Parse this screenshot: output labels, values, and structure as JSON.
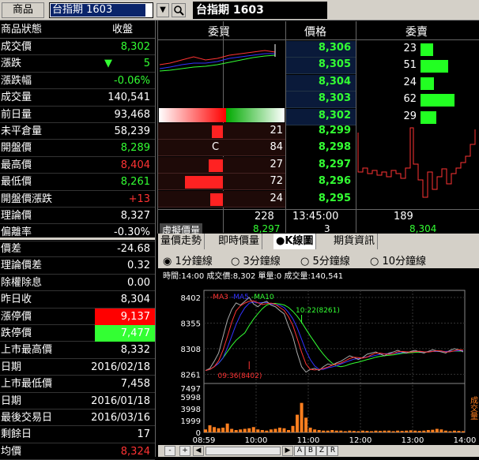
{
  "top": {
    "product_label": "商品",
    "input_value": "台指期  1603",
    "title": "台指期   1603"
  },
  "left_header": {
    "k": "商品狀態",
    "v": "收盤"
  },
  "left_rows": [
    {
      "k": "成交價",
      "v": "8,302",
      "c": "g"
    },
    {
      "k": "漲跌",
      "v": "5",
      "c": "g",
      "arrow": "▼"
    },
    {
      "k": "漲跌幅",
      "v": "-0.06%",
      "c": "g"
    },
    {
      "k": "成交量",
      "v": "140,541",
      "c": "w"
    },
    {
      "k": "前日量",
      "v": "93,468",
      "c": "w"
    },
    {
      "k": "未平倉量",
      "v": "58,239",
      "c": "w"
    },
    {
      "k": "開盤價",
      "v": "8,289",
      "c": "g"
    },
    {
      "k": "最高價",
      "v": "8,404",
      "c": "r"
    },
    {
      "k": "最低價",
      "v": "8,261",
      "c": "g"
    },
    {
      "k": "開盤價漲跌",
      "v": "+13",
      "c": "r"
    },
    {
      "k": "理論價",
      "v": "8,327",
      "c": "w"
    },
    {
      "k": "偏離率",
      "v": "-0.30%",
      "c": "w"
    }
  ],
  "left_rows2": [
    {
      "k": "價差",
      "v": "-24.68",
      "c": "w"
    },
    {
      "k": "理論價差",
      "v": "0.32",
      "c": "w"
    },
    {
      "k": "除權除息",
      "v": "0.00",
      "c": "w"
    },
    {
      "k": "昨日收",
      "v": "8,304",
      "c": "w"
    },
    {
      "k": "漲停價",
      "v": "9,137",
      "c": "w",
      "bg": "#ff0000"
    },
    {
      "k": "跌停價",
      "v": "7,477",
      "c": "w",
      "bg": "#33ff33"
    },
    {
      "k": "上市最高價",
      "v": "8,332",
      "c": "w"
    },
    {
      "k": "日期",
      "v": "2016/02/18",
      "c": "w"
    },
    {
      "k": "上市最低價",
      "v": "7,458",
      "c": "w"
    },
    {
      "k": "日期",
      "v": "2016/01/18",
      "c": "w"
    },
    {
      "k": "最後交易日",
      "v": "2016/03/16",
      "c": "w"
    },
    {
      "k": "剩餘日",
      "v": "17",
      "c": "w"
    },
    {
      "k": "均價",
      "v": "8,324",
      "c": "r"
    }
  ],
  "book_header": {
    "bid": "委買",
    "price": "價格",
    "ask": "委賣"
  },
  "asks": [
    {
      "price": "8,306",
      "qty": "23",
      "bar": 0.25
    },
    {
      "price": "8,305",
      "qty": "51",
      "bar": 0.55
    },
    {
      "price": "8,304",
      "qty": "24",
      "bar": 0.26
    },
    {
      "price": "8,303",
      "qty": "62",
      "bar": 0.67
    },
    {
      "price": "8,302",
      "qty": "29",
      "bar": 0.32
    }
  ],
  "bids": [
    {
      "price": "8,299",
      "qty": "21",
      "bar": 0.22,
      "mark": ""
    },
    {
      "price": "8,298",
      "qty": "84",
      "bar": 0.0,
      "mark": "C"
    },
    {
      "price": "8,297",
      "qty": "27",
      "bar": 0.28
    },
    {
      "price": "8,296",
      "qty": "72",
      "bar": 0.75
    },
    {
      "price": "8,295",
      "qty": "24",
      "bar": 0.25
    }
  ],
  "book_footer": {
    "bid_total": "228",
    "time": "13:45:00",
    "ask_total": "189",
    "sim_label": "虛擬價量",
    "sim_price": "8,297",
    "sim_qty": "3",
    "sim_ask": "8,304"
  },
  "tabs": [
    "量價走勢",
    "即時價量",
    "●K線圖",
    "期貨資訊"
  ],
  "radios": [
    "1分鐘線",
    "3分鐘線",
    "5分鐘線",
    "10分鐘線"
  ],
  "chart_data": {
    "type": "line",
    "info_bar": "時間:14:00  成交價:8,302  單量:0  成交量:140,541",
    "legend": [
      "MA3",
      "MA5",
      "MA10"
    ],
    "x_ticks": [
      "08:59",
      "10:00",
      "11:00",
      "12:00",
      "13:00",
      "14:00"
    ],
    "y_ticks": [
      "8402",
      "8355",
      "8308",
      "8261"
    ],
    "vol_ticks": [
      "7497",
      "5998",
      "3998",
      "1999",
      "0"
    ],
    "vol_label": "成交量",
    "annotations": [
      "10:22(8261)",
      "09:36(8402)"
    ],
    "ylim": [
      8250,
      8415
    ],
    "price": [
      8268,
      8272,
      8285,
      8300,
      8330,
      8360,
      8380,
      8392,
      8388,
      8395,
      8402,
      8390,
      8385,
      8392,
      8395,
      8388,
      8385,
      8378,
      8372,
      8350,
      8330,
      8300,
      8275,
      8265,
      8270,
      8272,
      8268,
      8275,
      8280,
      8278,
      8282,
      8285,
      8290,
      8295,
      8292,
      8288,
      8292,
      8298,
      8300,
      8302,
      8298,
      8295,
      8300,
      8302,
      8305,
      8302,
      8300,
      8303,
      8305,
      8302,
      8300,
      8303,
      8306,
      8304,
      8302,
      8300,
      8305,
      8308,
      8306,
      8302
    ],
    "volume": [
      500,
      1200,
      900,
      700,
      800,
      1500,
      600,
      400,
      500,
      600,
      700,
      900,
      500,
      400,
      300,
      500,
      600,
      800,
      700,
      400,
      1100,
      3000,
      5000,
      2500,
      800,
      500,
      400,
      300,
      300,
      400,
      300,
      300,
      200,
      300,
      250,
      200,
      300,
      250,
      200,
      300,
      250,
      300,
      300,
      200,
      300,
      250,
      300,
      350,
      300,
      250,
      300,
      400,
      450,
      600,
      500,
      300,
      200,
      300,
      250,
      200
    ]
  },
  "bottom_buttons": [
    "-",
    "+",
    "A",
    "B",
    "Z",
    "R"
  ]
}
